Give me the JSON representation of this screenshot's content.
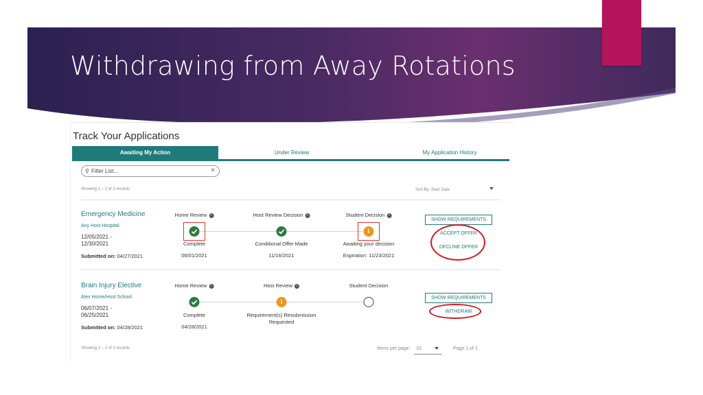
{
  "slide": {
    "title": "Withdrawing from Away Rotations"
  },
  "app": {
    "heading": "Track Your Applications",
    "tabs": [
      {
        "label": "Awaiting My Action"
      },
      {
        "label": "Under Review"
      },
      {
        "label": "My Application History"
      }
    ],
    "filter_placeholder": "Filter List...",
    "showing_top": "Showing 1 – 2 of 2 records",
    "sort_label": "Sort By: Start Date",
    "showing_bottom": "Showing 1 – 2 of 2 records",
    "items_per_page_label": "Items per page:",
    "items_per_page_value": "10",
    "page_label": "Page 1 of 1",
    "rows": [
      {
        "title": "Emergency Medicine",
        "host": "Any Host Hospital",
        "date_start": "12/05/2021 -",
        "date_end": "12/30/2021",
        "submitted_label": "Submitted on:",
        "submitted_value": "04/27/2021",
        "steps": [
          {
            "label": "Home Review",
            "state": "complete",
            "status": "Complete",
            "date": "06/01/2021"
          },
          {
            "label": "Host Review Decision",
            "state": "complete",
            "status": "Conditional Offer Made",
            "date": "11/16/2021"
          },
          {
            "label": "Student Decision",
            "state": "warning",
            "status": "Awaiting your decision",
            "date": "Expiration: 11/23/2021"
          }
        ],
        "show_requirements": "SHOW REQUIREMENTS",
        "actions": [
          "ACCEPT OFFER",
          "DECLINE OFFER"
        ]
      },
      {
        "title": "Brain Injury Elective",
        "host": "Alex Home/Host School",
        "date_start": "06/07/2021 -",
        "date_end": "06/25/2021",
        "submitted_label": "Submitted on:",
        "submitted_value": "04/28/2021",
        "steps": [
          {
            "label": "Home Review",
            "state": "complete",
            "status": "Complete",
            "date": "04/28/2021"
          },
          {
            "label": "Host Review",
            "state": "warning",
            "status": "Requirement(s) Resubmission",
            "date": "Requested"
          },
          {
            "label": "Student Decision",
            "state": "empty",
            "status": "",
            "date": ""
          }
        ],
        "show_requirements": "SHOW REQUIREMENTS",
        "actions": [
          "WITHDRAW"
        ]
      }
    ]
  },
  "icons": {
    "complete": "check-circle-icon",
    "warning": "info-circle-icon",
    "empty": "empty-circle-icon",
    "info": "info-icon"
  },
  "colors": {
    "teal": "#1f7a7a",
    "check_green": "#2c7a40",
    "warn_orange": "#f0961e",
    "highlight_red": "#d8161e",
    "accent_magenta": "#b5135b"
  }
}
